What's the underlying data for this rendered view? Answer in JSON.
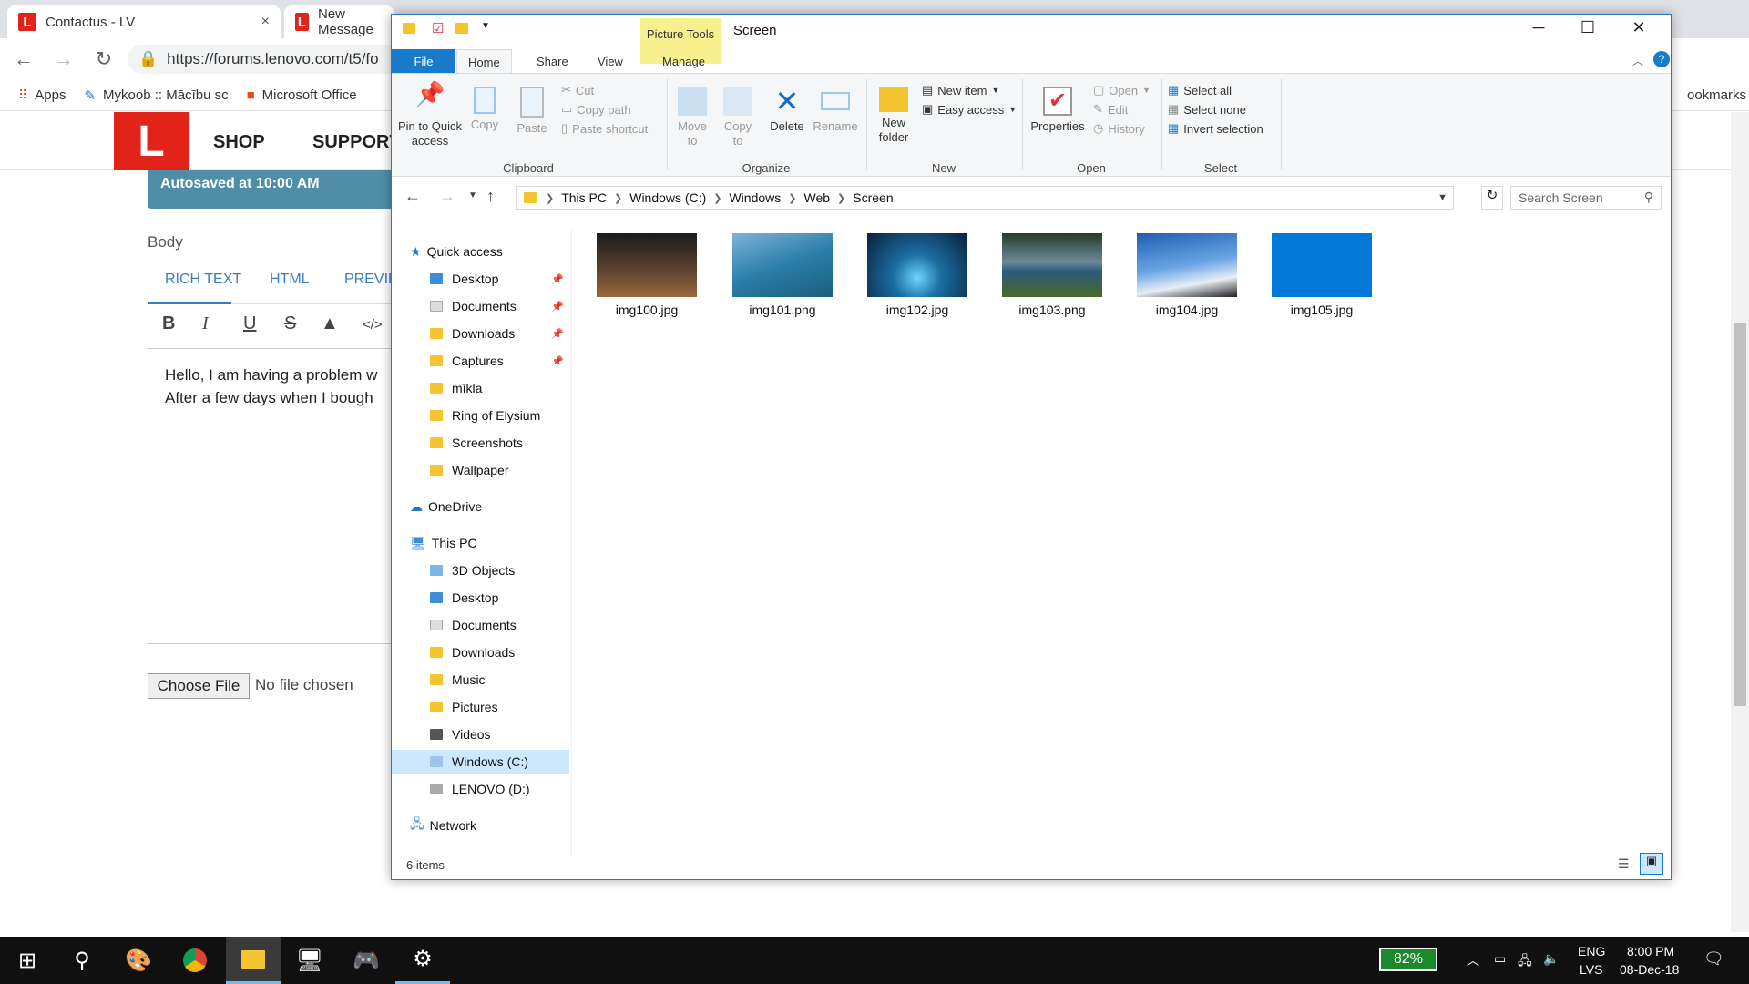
{
  "browser": {
    "tabs": [
      {
        "title": "Contactus - LV",
        "close": "×"
      },
      {
        "title": "New Message"
      }
    ],
    "url": "https://forums.lenovo.com/t5/fo",
    "bookmarks": [
      "Apps",
      "Mykoob :: Mācību sc",
      "Microsoft Office"
    ],
    "bookmarks_right": "ookmarks"
  },
  "site": {
    "logo": "L",
    "nav": [
      "SHOP",
      "SUPPORT"
    ],
    "autosave": "Autosaved at 10:00 AM",
    "body_label": "Body",
    "editor_tabs": [
      "RICH TEXT",
      "HTML",
      "PREVIE"
    ],
    "format_buttons": [
      "B",
      "I",
      "U",
      "S",
      "▲",
      "</>"
    ],
    "editor_lines": [
      "Hello, I am having a problem w",
      "After a few days when I bough"
    ],
    "choose_file": "Choose File",
    "no_file": "No file chosen"
  },
  "explorer": {
    "title": "Screen",
    "picture_tools": "Picture Tools",
    "ribbon_tabs": [
      "File",
      "Home",
      "Share",
      "View",
      "Manage"
    ],
    "ribbon": {
      "pin": "Pin to Quick access",
      "copy": "Copy",
      "paste": "Paste",
      "cut": "Cut",
      "copy_path": "Copy path",
      "paste_shortcut": "Paste shortcut",
      "clipboard": "Clipboard",
      "move_to": "Move to",
      "copy_to": "Copy to",
      "delete": "Delete",
      "rename": "Rename",
      "organize": "Organize",
      "new_folder": "New folder",
      "new_item": "New item",
      "easy_access": "Easy access",
      "new": "New",
      "properties": "Properties",
      "open": "Open",
      "edit": "Edit",
      "history": "History",
      "open_group": "Open",
      "select_all": "Select all",
      "select_none": "Select none",
      "invert_selection": "Invert selection",
      "select": "Select"
    },
    "breadcrumb": [
      "This PC",
      "Windows (C:)",
      "Windows",
      "Web",
      "Screen"
    ],
    "search_placeholder": "Search Screen",
    "nav": {
      "quick_access": "Quick access",
      "quick_items": [
        {
          "label": "Desktop",
          "pinned": true
        },
        {
          "label": "Documents",
          "pinned": true
        },
        {
          "label": "Downloads",
          "pinned": true
        },
        {
          "label": "Captures",
          "pinned": true
        },
        {
          "label": "mīkla"
        },
        {
          "label": "Ring of Elysium"
        },
        {
          "label": "Screenshots"
        },
        {
          "label": "Wallpaper"
        }
      ],
      "onedrive": "OneDrive",
      "this_pc": "This PC",
      "pc_items": [
        "3D Objects",
        "Desktop",
        "Documents",
        "Downloads",
        "Music",
        "Pictures",
        "Videos",
        "Windows (C:)",
        "LENOVO (D:)"
      ],
      "network": "Network"
    },
    "files": [
      {
        "name": "img100.jpg",
        "bg": "linear-gradient(180deg,#1b1b1b 0%,#5a4030 55%,#9a6a3a 100%)"
      },
      {
        "name": "img101.png",
        "bg": "linear-gradient(160deg,#7fb2d8 0%,#2a7fa8 50%,#1b5e7e 100%)"
      },
      {
        "name": "img102.jpg",
        "bg": "radial-gradient(circle at 50% 70%,#6fd3ff 0%,#1a6fa3 35%,#0a1f3a 100%)"
      },
      {
        "name": "img103.png",
        "bg": "linear-gradient(180deg,#2a3a2a 0%,#6b8a9a 45%,#2b5a7a 60%,#4a6a2a 100%)"
      },
      {
        "name": "img104.jpg",
        "bg": "linear-gradient(170deg,#1f5fb0 0%,#6aa4e6 50%,#e8eef6 75%,#202020 100%)"
      },
      {
        "name": "img105.jpg",
        "bg": "#0078d7"
      }
    ],
    "status": "6 items"
  },
  "taskbar": {
    "battery": "82%",
    "lang1": "ENG",
    "lang2": "LVS",
    "time": "8:00 PM",
    "date": "08-Dec-18"
  }
}
